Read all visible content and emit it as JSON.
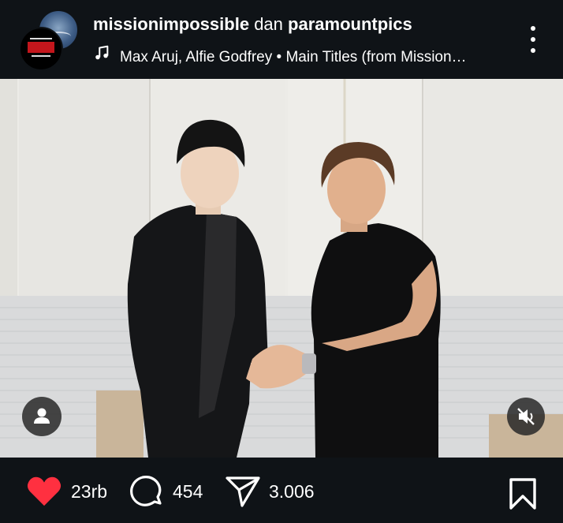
{
  "header": {
    "account1": "missionimpossible",
    "joiner": "dan",
    "account2": "paramountpics",
    "music_text": "Max Aruj, Alfie Godfrey • Main Titles (from Mission…",
    "icons": {
      "music": "music-note-icon",
      "more": "more-vertical-icon"
    }
  },
  "media": {
    "description_icons": {
      "profile": "user-icon",
      "mute": "volume-muted-icon"
    }
  },
  "actions": {
    "likes": "23rb",
    "comments": "454",
    "shares": "3.006",
    "icons": {
      "like": "heart-icon",
      "comment": "comment-icon",
      "share": "send-icon",
      "save": "bookmark-icon"
    },
    "like_color": "#ff3040"
  }
}
